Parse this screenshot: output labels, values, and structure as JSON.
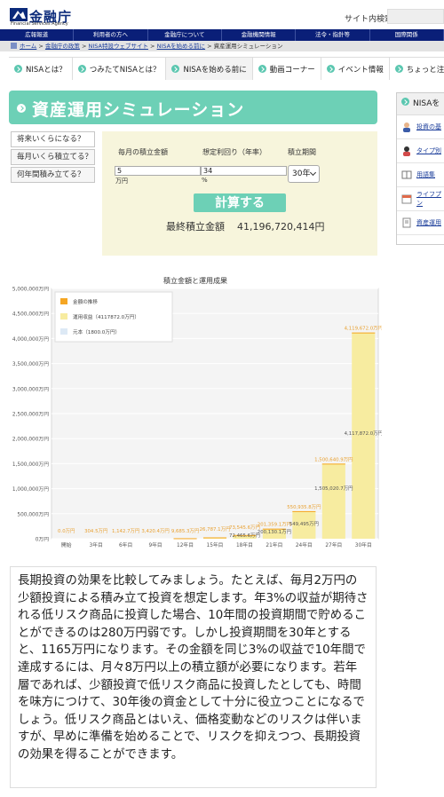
{
  "header": {
    "logo_text": "金融庁",
    "logo_sub": "Financial Services Agency",
    "search_label": "サイト内検索"
  },
  "gnav": [
    "広報報道",
    "利用者の方へ",
    "金融庁について",
    "金融機関情報",
    "法令・指針等",
    "国際関係"
  ],
  "breadcrumb": [
    "ホーム",
    "金融庁の政策",
    "NISA特設ウェブサイト",
    "NISAを始める前に",
    "資産運用シミュレーション"
  ],
  "subnav": [
    "NISAとは？",
    "つみたてNISAとは？",
    "NISAを始める前に",
    "動画コーナー",
    "イベント情報",
    "ちょっと注目！"
  ],
  "page_title": "資産運用シミュレーション",
  "sidebar": {
    "header": "NISAを",
    "items": [
      "投資の基",
      "タイプ別",
      "用語集",
      "ライフプ\nン",
      "資産運用"
    ]
  },
  "side_tabs": [
    "将来いくらになる？",
    "毎月いくら積立てる？",
    "何年間積み立てる？"
  ],
  "form": {
    "monthly_label": "毎月の積立金額",
    "rate_label": "想定利回り（年率）",
    "period_label": "積立期間",
    "monthly_value": "5",
    "monthly_unit": "万円",
    "rate_value": "34",
    "rate_unit": "%",
    "period_value": "30年",
    "calc_label": "計算する",
    "result_label": "最終積立金額",
    "result_value": "41,196,720,414円"
  },
  "chart_data": {
    "type": "bar",
    "title": "積立金額と運用成果",
    "categories": [
      "開始",
      "3年目",
      "6年目",
      "9年目",
      "12年目",
      "15年目",
      "18年目",
      "21年目",
      "24年目",
      "27年目",
      "30年目"
    ],
    "ylim": [
      0,
      5000000
    ],
    "yticks": [
      0,
      500000,
      1000000,
      1500000,
      2000000,
      2500000,
      3000000,
      3500000,
      4000000,
      4500000,
      5000000
    ],
    "ytick_labels": [
      "0万円",
      "500,000万円",
      "1,000,000万円",
      "1,500,000万円",
      "2,000,000万円",
      "2,500,000万円",
      "3,000,000万円",
      "3,500,000万円",
      "4,000,000万円",
      "4,500,000万円",
      "5,000,000万円"
    ],
    "legend": [
      "金額の推移",
      "運用収益（4117872.0万円）",
      "元本（1800.0万円）"
    ],
    "legend_colors": [
      "#f5a623",
      "#f7eca0",
      "#dde9f5"
    ],
    "legend_position": "top-left",
    "grid": true,
    "series": [
      {
        "name": "金額の推移",
        "values": [
          0,
          305,
          1142,
          3420,
          9685,
          26787,
          73545,
          201359,
          550935,
          1500640,
          4119672
        ]
      },
      {
        "name": "運用収益",
        "values": [
          0,
          125,
          782,
          2880,
          8965,
          25887,
          72465,
          200130,
          549495,
          1505020,
          4117872
        ]
      }
    ],
    "top_labels": [
      "0.0万円",
      "304.5万円",
      "1,142.7万円",
      "3,420.4万円",
      "9,685.3万円",
      "26,787.1万円",
      "73,545.6万円",
      "201,359.1万円",
      "550,935.8万円",
      "1,500,640.9万円",
      "4,119,672.0万円"
    ],
    "inner_labels": [
      "",
      "",
      "",
      "",
      "",
      "",
      "72,465.6万円",
      "200,130.1万円",
      "549,495万円",
      "1,505,020.7万円",
      "4,117,872.0万円"
    ],
    "colors": {
      "bar": "#f7eca0",
      "bar_top": "#f5a623",
      "label": "#e8a030",
      "plot_bg": "#f4f4f4",
      "grid": "#ffffff"
    }
  },
  "body_text": "長期投資の効果を比較してみましょう。たとえば、毎月2万円の少額投資による積み立て投資を想定します。年3%の収益が期待される低リスク商品に投資した場合、10年間の投資期間で貯めることができるのは280万円弱です。しかし投資期間を30年とすると、1165万円になります。その金額を同じ3%の収益で10年間で達成するには、月々8万円以上の積立額が必要になります。若年層であれば、少額投資で低リスク商品に投資したとしても、時間を味方につけて、30年後の資金として十分に役立つことになるでしょう。低リスク商品とはいえ、価格変動などのリスクは伴いますが、早めに準備を始めることで、リスクを抑えつつ、長期投資の効果を得ることができます。"
}
